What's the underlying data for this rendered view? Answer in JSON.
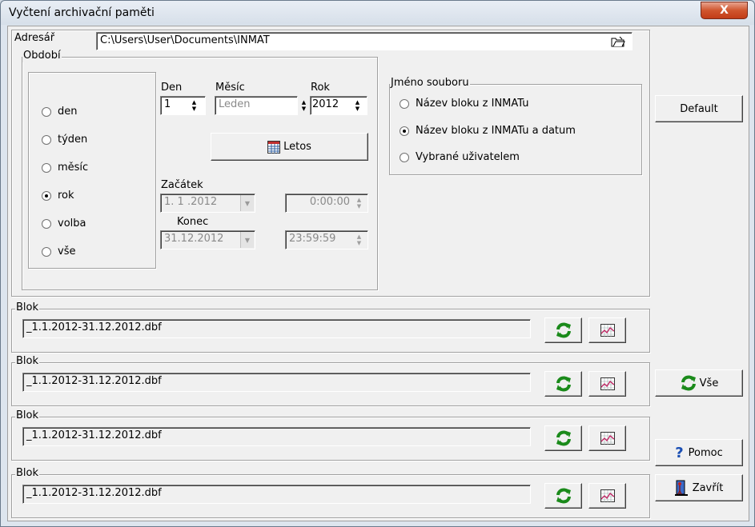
{
  "window": {
    "title": "Vyčtení archivační paměti",
    "close_label": "X"
  },
  "address": {
    "label": "Adresář",
    "value": "C:\\Users\\User\\Documents\\INMAT"
  },
  "period": {
    "legend": "Období",
    "options": [
      {
        "label": "den",
        "checked": false
      },
      {
        "label": "týden",
        "checked": false
      },
      {
        "label": "měsíc",
        "checked": false
      },
      {
        "label": "rok",
        "checked": true
      },
      {
        "label": "volba",
        "checked": false
      },
      {
        "label": "vše",
        "checked": false
      }
    ],
    "day_label": "Den",
    "day_value": "1",
    "month_label": "Měsíc",
    "month_value": "Leden",
    "year_label": "Rok",
    "year_value": "2012",
    "letos_label": "Letos",
    "start_label": "Začátek",
    "start_date": "1. 1 .2012",
    "start_time": "0:00:00",
    "end_label": "Konec",
    "end_date": "31.12.2012",
    "end_time": "23:59:59"
  },
  "filename": {
    "legend": "Jméno souboru",
    "options": [
      {
        "label": "Název bloku z INMATu",
        "checked": false
      },
      {
        "label": "Název bloku z INMATu a datum",
        "checked": true
      },
      {
        "label": "Vybrané uživatelem",
        "checked": false
      }
    ]
  },
  "blocks": [
    {
      "legend": "Blok",
      "file": "_1.1.2012-31.12.2012.dbf"
    },
    {
      "legend": "Blok",
      "file": "_1.1.2012-31.12.2012.dbf"
    },
    {
      "legend": "Blok",
      "file": "_1.1.2012-31.12.2012.dbf"
    },
    {
      "legend": "Blok",
      "file": "_1.1.2012-31.12.2012.dbf"
    }
  ],
  "side": {
    "default_label": "Default",
    "all_label": "Vše",
    "help_label": "Pomoc",
    "close_label": "Zavřít"
  }
}
